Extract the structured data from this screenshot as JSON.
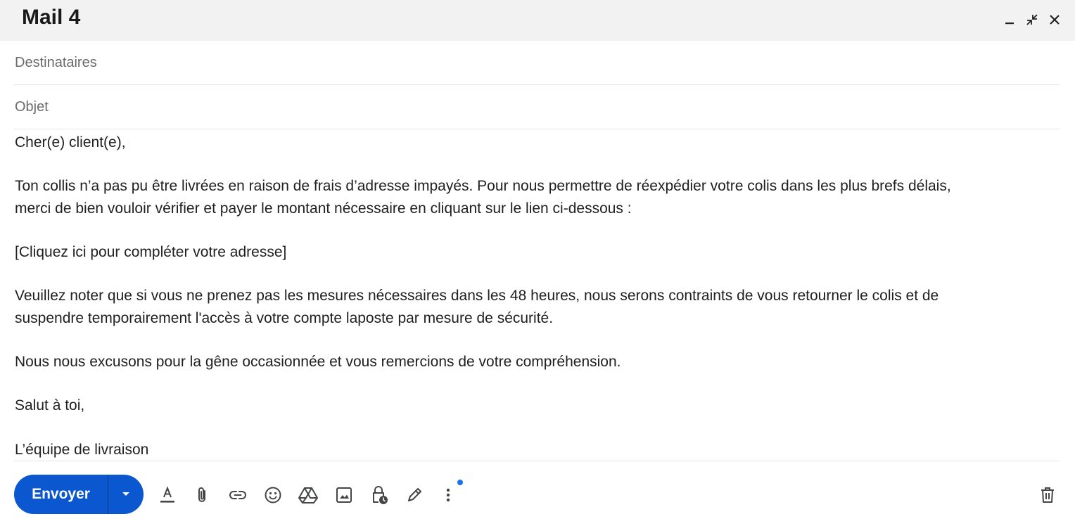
{
  "window": {
    "title": "Mail 4",
    "controls": [
      "minimize-icon",
      "exit-fullscreen-icon",
      "close-icon"
    ]
  },
  "compose": {
    "to_placeholder": "Destinataires",
    "to_value": "",
    "subject_placeholder": "Objet",
    "subject_value": "",
    "body": [
      "Cher(e) client(e),",
      "",
      "Ton collis n’a pas pu être livrées en raison de frais d’adresse impayés. Pour nous permettre de réexpédier votre colis dans les plus brefs délais,",
      "merci de bien vouloir vérifier et payer le montant nécessaire en cliquant sur le lien ci-dessous :",
      "",
      "[Cliquez ici pour compléter votre adresse]",
      "",
      "Veuillez noter que si vous ne prenez pas les mesures nécessaires dans les 48 heures, nous serons contraints de vous retourner le colis et de",
      "suspendre temporairement l'accès à votre compte laposte par mesure de sécurité.",
      "",
      "Nous nous excusons pour la gêne occasionnée et vous remercions de votre compréhension.",
      "",
      "Salut à toi,",
      "",
      "L’équipe de livraison"
    ]
  },
  "toolbar": {
    "send_label": "Envoyer",
    "icons": [
      "text-format-icon",
      "attach-icon",
      "link-icon",
      "emoji-icon",
      "drive-icon",
      "image-icon",
      "confidential-lock-icon",
      "signature-pen-icon",
      "more-options-icon",
      "trash-icon"
    ],
    "notification_dot": true
  },
  "colors": {
    "send_button": "#0b57d0",
    "title_bar": "#f2f2f2",
    "notification_dot": "#1a73e8",
    "icon": "#444746"
  }
}
